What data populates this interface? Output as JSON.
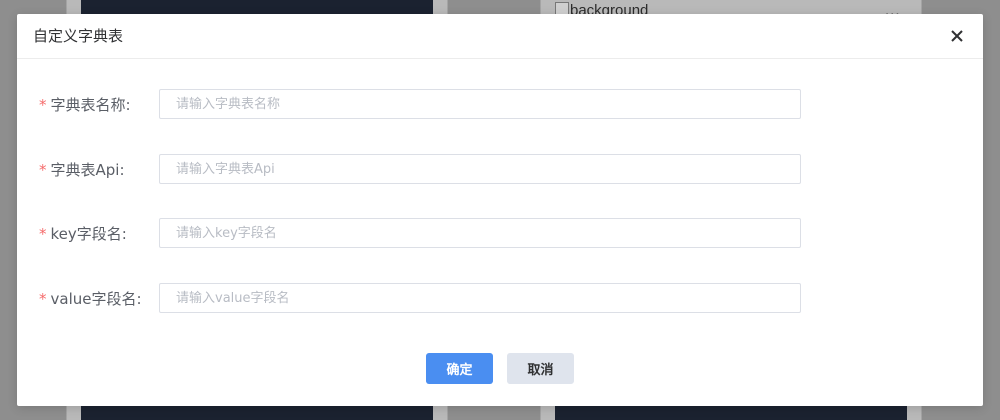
{
  "background": {
    "right_card_title": "background",
    "right_card_dots": "..."
  },
  "dialog": {
    "title": "自定义字典表",
    "close_icon": "close-icon",
    "required_mark": "*",
    "fields": [
      {
        "label": "字典表名称:",
        "placeholder": "请输入字典表名称",
        "value": ""
      },
      {
        "label": "字典表Api:",
        "placeholder": "请输入字典表Api",
        "value": ""
      },
      {
        "label": "key字段名:",
        "placeholder": "请输入key字段名",
        "value": ""
      },
      {
        "label": "value字段名:",
        "placeholder": "请输入value字段名",
        "value": ""
      }
    ],
    "confirm_label": "确定",
    "cancel_label": "取消"
  },
  "colors": {
    "primary": "#4a8ef1",
    "required": "#f56c6c",
    "overlay": "#8e8e8e"
  }
}
